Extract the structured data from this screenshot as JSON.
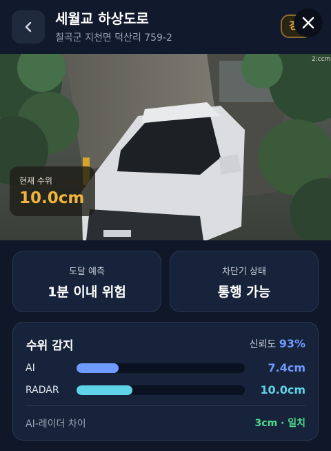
{
  "header": {
    "title": "세월교 하상도로",
    "subtitle": "칠곡군 지천면 덕산리 759-2",
    "chip_text": "경보"
  },
  "camera": {
    "watermark": "2:ccm",
    "current_level": {
      "label": "현재 수위",
      "value": "10.0cm"
    }
  },
  "cards": [
    {
      "label": "도달 예측",
      "value": "1분 이내 위험"
    },
    {
      "label": "차단기 상태",
      "value": "통행 가능"
    }
  ],
  "detection": {
    "title": "수위 감지",
    "confidence_label": "신뢰도",
    "confidence_value": "93%",
    "rows": [
      {
        "label": "AI",
        "value": "7.4cm",
        "fill_fraction": 0.25,
        "color": "#6f9bff"
      },
      {
        "label": "RADAR",
        "value": "10.0cm",
        "fill_fraction": 0.33,
        "color": "#5fd3e8"
      }
    ],
    "difference_label": "AI-레이더 차이",
    "difference_value": "3cm · 일치"
  },
  "colors": {
    "accent_blue": "#6f9bff",
    "accent_cyan": "#5fd3e8",
    "warning_orange": "#f0b43b",
    "ok_green": "#4fdb8e"
  },
  "icons": [
    "chevron-left-icon",
    "close-icon"
  ]
}
